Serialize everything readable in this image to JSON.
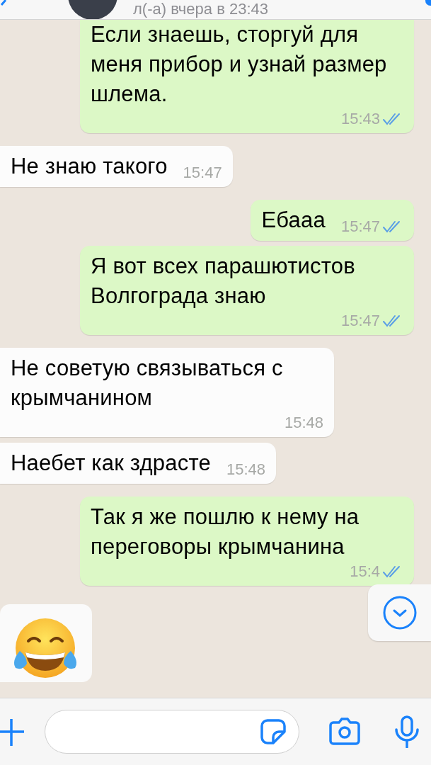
{
  "header": {
    "status": "л(-а) вчера в 23:43"
  },
  "messages": [
    {
      "kind": "outgoing",
      "text": "Если знаешь, сторгуй для меня прибор и узнай размер шлема.",
      "time": "15:43",
      "read": true
    },
    {
      "kind": "incoming",
      "text": "Не знаю такого",
      "time": "15:47"
    },
    {
      "kind": "outgoing",
      "text": "Ебааа",
      "time": "15:47",
      "read": true
    },
    {
      "kind": "outgoing",
      "text": "Я вот всех парашютистов Волгограда знаю",
      "time": "15:47",
      "read": true
    },
    {
      "kind": "incoming",
      "text": "Не советую связываться с крымчанином",
      "time": "15:48"
    },
    {
      "kind": "incoming",
      "text": "Наебет как здрасте",
      "time": "15:48"
    },
    {
      "kind": "outgoing",
      "text": "Так я же пошлю к нему на переговоры крымчанина",
      "time": "15:4",
      "read": true
    },
    {
      "kind": "emoji"
    }
  ]
}
